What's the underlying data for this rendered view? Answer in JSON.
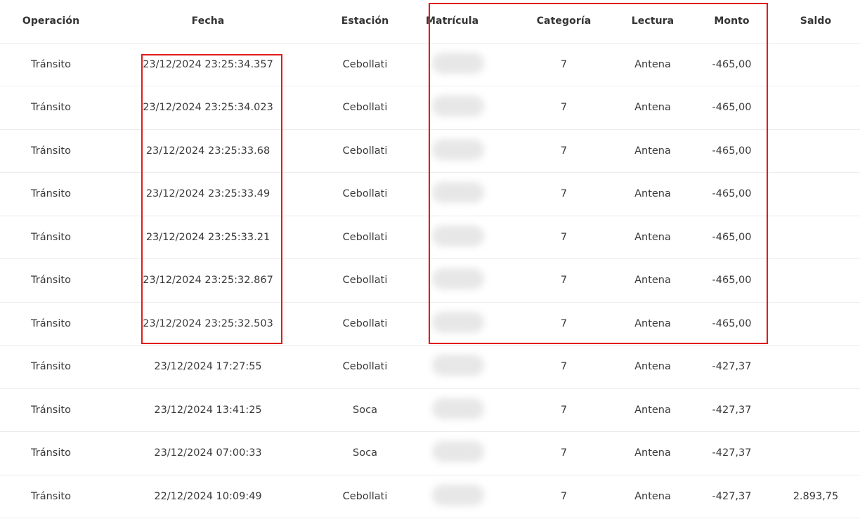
{
  "table": {
    "headers": {
      "operacion": "Operación",
      "fecha": "Fecha",
      "estacion": "Estación",
      "matricula": "Matrícula",
      "categoria": "Categoría",
      "lectura": "Lectura",
      "monto": "Monto",
      "saldo": "Saldo"
    },
    "rows": [
      {
        "operacion": "Tránsito",
        "fecha": "23/12/2024 23:25:34.357",
        "estacion": "Cebollati",
        "categoria": "7",
        "lectura": "Antena",
        "monto": "-465,00",
        "saldo": ""
      },
      {
        "operacion": "Tránsito",
        "fecha": "23/12/2024 23:25:34.023",
        "estacion": "Cebollati",
        "categoria": "7",
        "lectura": "Antena",
        "monto": "-465,00",
        "saldo": ""
      },
      {
        "operacion": "Tránsito",
        "fecha": "23/12/2024 23:25:33.68",
        "estacion": "Cebollati",
        "categoria": "7",
        "lectura": "Antena",
        "monto": "-465,00",
        "saldo": ""
      },
      {
        "operacion": "Tránsito",
        "fecha": "23/12/2024 23:25:33.49",
        "estacion": "Cebollati",
        "categoria": "7",
        "lectura": "Antena",
        "monto": "-465,00",
        "saldo": ""
      },
      {
        "operacion": "Tránsito",
        "fecha": "23/12/2024 23:25:33.21",
        "estacion": "Cebollati",
        "categoria": "7",
        "lectura": "Antena",
        "monto": "-465,00",
        "saldo": ""
      },
      {
        "operacion": "Tránsito",
        "fecha": "23/12/2024 23:25:32.867",
        "estacion": "Cebollati",
        "categoria": "7",
        "lectura": "Antena",
        "monto": "-465,00",
        "saldo": ""
      },
      {
        "operacion": "Tránsito",
        "fecha": "23/12/2024 23:25:32.503",
        "estacion": "Cebollati",
        "categoria": "7",
        "lectura": "Antena",
        "monto": "-465,00",
        "saldo": ""
      },
      {
        "operacion": "Tránsito",
        "fecha": "23/12/2024 17:27:55",
        "estacion": "Cebollati",
        "categoria": "7",
        "lectura": "Antena",
        "monto": "-427,37",
        "saldo": ""
      },
      {
        "operacion": "Tránsito",
        "fecha": "23/12/2024 13:41:25",
        "estacion": "Soca",
        "categoria": "7",
        "lectura": "Antena",
        "monto": "-427,37",
        "saldo": ""
      },
      {
        "operacion": "Tránsito",
        "fecha": "23/12/2024 07:00:33",
        "estacion": "Soca",
        "categoria": "7",
        "lectura": "Antena",
        "monto": "-427,37",
        "saldo": ""
      },
      {
        "operacion": "Tránsito",
        "fecha": "22/12/2024 10:09:49",
        "estacion": "Cebollati",
        "categoria": "7",
        "lectura": "Antena",
        "monto": "-427,37",
        "saldo": "2.893,75"
      }
    ]
  },
  "annotations": {
    "highlight_color": "#e01b1b"
  }
}
